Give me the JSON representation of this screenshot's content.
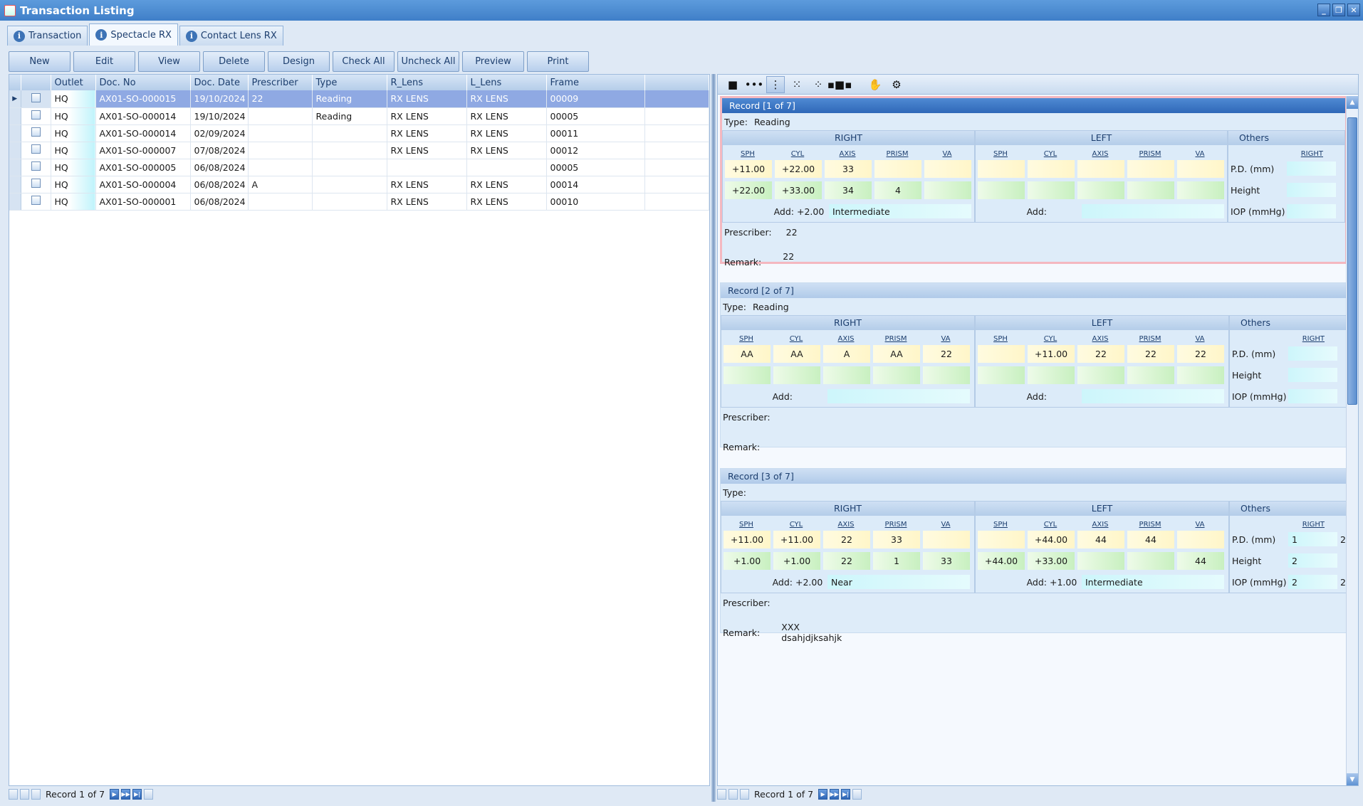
{
  "window": {
    "title": "Transaction Listing"
  },
  "tabs": [
    {
      "label": "Transaction"
    },
    {
      "label": "Spectacle RX"
    },
    {
      "label": "Contact Lens RX"
    }
  ],
  "toolbar": [
    "New",
    "Edit",
    "View",
    "Delete",
    "Design",
    "Check All",
    "Uncheck All",
    "Preview",
    "Print"
  ],
  "grid": {
    "columns": [
      "Outlet",
      "Doc. No",
      "Doc. Date",
      "Prescriber",
      "Type",
      "R_Lens",
      "L_Lens",
      "Frame"
    ],
    "rows": [
      [
        "HQ",
        "AX01-SO-000015",
        "19/10/2024",
        "22",
        "Reading",
        "RX LENS",
        "RX LENS",
        "00009"
      ],
      [
        "HQ",
        "AX01-SO-000014",
        "19/10/2024",
        "",
        "Reading",
        "RX LENS",
        "RX LENS",
        "00005"
      ],
      [
        "HQ",
        "AX01-SO-000014",
        "02/09/2024",
        "",
        "",
        "RX LENS",
        "RX LENS",
        "00011"
      ],
      [
        "HQ",
        "AX01-SO-000007",
        "07/08/2024",
        "",
        "",
        "RX LENS",
        "RX LENS",
        "00012"
      ],
      [
        "HQ",
        "AX01-SO-000005",
        "06/08/2024",
        "",
        "",
        "",
        "",
        "00005"
      ],
      [
        "HQ",
        "AX01-SO-000004",
        "06/08/2024",
        "A",
        "",
        "RX LENS",
        "RX LENS",
        "00014"
      ],
      [
        "HQ",
        "AX01-SO-000001",
        "06/08/2024",
        "",
        "",
        "RX LENS",
        "RX LENS",
        "00010"
      ]
    ]
  },
  "nav": {
    "left": "Record 1 of 7",
    "right": "Record 1 of 7"
  },
  "labels": {
    "type": "Type:",
    "right": "RIGHT",
    "left": "LEFT",
    "others": "Others",
    "sph": "SPH",
    "cyl": "CYL",
    "axis": "AXIS",
    "prism": "PRISM",
    "va": "VA",
    "oright": "RIGHT",
    "add": "Add:",
    "pd": "P.D. (mm)",
    "height": "Height",
    "iop": "IOP (mmHg)",
    "prescriber": "Prescriber:",
    "remark": "Remark:"
  },
  "records": [
    {
      "header": "Record [1 of 7]",
      "type": "Reading",
      "right": {
        "r1": [
          "+11.00",
          "+22.00",
          "33",
          "",
          ""
        ],
        "r2": [
          "+22.00",
          "+33.00",
          "34",
          "4",
          ""
        ],
        "add": "+2.00",
        "addtext": "Intermediate"
      },
      "left": {
        "r1": [
          "",
          "",
          "",
          "",
          ""
        ],
        "r2": [
          "",
          "",
          "",
          "",
          ""
        ],
        "add": "",
        "addtext": ""
      },
      "others": {
        "pd": "",
        "height": "",
        "iop": "",
        "pd2": "",
        "height2": "",
        "iop2": ""
      },
      "prescriber": "22",
      "remark": "22",
      "remark2": ""
    },
    {
      "header": "Record [2 of 7]",
      "type": "Reading",
      "right": {
        "r1": [
          "AA",
          "AA",
          "A",
          "AA",
          "22"
        ],
        "r2": [
          "",
          "",
          "",
          "",
          ""
        ],
        "add": "",
        "addtext": ""
      },
      "left": {
        "r1": [
          "",
          "+11.00",
          "22",
          "22",
          "22"
        ],
        "r2": [
          "",
          "",
          "",
          "",
          ""
        ],
        "add": "",
        "addtext": ""
      },
      "others": {
        "pd": "",
        "height": "",
        "iop": "",
        "pd2": "",
        "height2": "",
        "iop2": ""
      },
      "prescriber": "",
      "remark": "",
      "remark2": ""
    },
    {
      "header": "Record [3 of 7]",
      "type": "",
      "right": {
        "r1": [
          "+11.00",
          "+11.00",
          "22",
          "33",
          ""
        ],
        "r2": [
          "+1.00",
          "+1.00",
          "22",
          "1",
          "33"
        ],
        "add": "+2.00",
        "addtext": "Near"
      },
      "left": {
        "r1": [
          "",
          "+44.00",
          "44",
          "44",
          ""
        ],
        "r2": [
          "+44.00",
          "+33.00",
          "",
          "",
          "44"
        ],
        "add": "+1.00",
        "addtext": "Intermediate"
      },
      "others": {
        "pd": "1",
        "height": "2",
        "iop": "2",
        "pd2": "2",
        "height2": "",
        "iop2": "2"
      },
      "prescriber": "",
      "remark": "XXX",
      "remark2": "dsahjdjksahjk"
    }
  ]
}
